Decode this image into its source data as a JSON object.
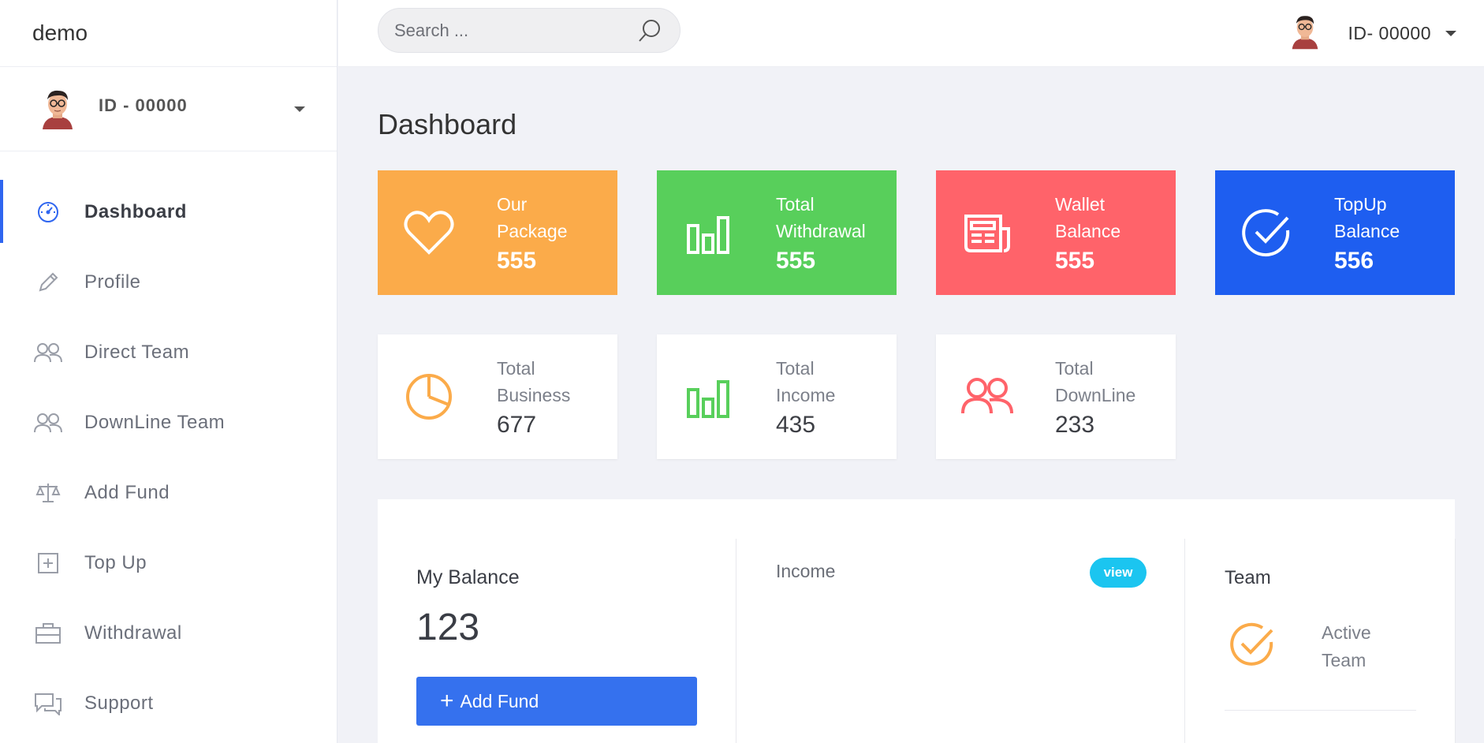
{
  "brand": "demo",
  "sidebar": {
    "user_id": "ID - 00000",
    "items": [
      {
        "label": "Dashboard",
        "icon": "dashboard-gauge-icon",
        "active": true
      },
      {
        "label": "Profile",
        "icon": "pencil-icon"
      },
      {
        "label": "Direct Team",
        "icon": "users-icon"
      },
      {
        "label": "DownLine Team",
        "icon": "users-icon"
      },
      {
        "label": "Add Fund",
        "icon": "scale-icon"
      },
      {
        "label": "Top Up",
        "icon": "plus-square-icon"
      },
      {
        "label": "Withdrawal",
        "icon": "briefcase-icon"
      },
      {
        "label": "Support",
        "icon": "chat-icon"
      }
    ]
  },
  "header": {
    "search_placeholder": "Search ...",
    "user_id": "ID- 00000"
  },
  "page_title": "Dashboard",
  "cards_top": [
    {
      "label1": "Our",
      "label2": "Package",
      "value": "555",
      "color": "#fbab4a",
      "icon": "heart-icon"
    },
    {
      "label1": "Total",
      "label2": "Withdrawal",
      "value": "555",
      "color": "#58cf5b",
      "icon": "bar-chart-icon"
    },
    {
      "label1": "Wallet",
      "label2": "Balance",
      "value": "555",
      "color": "#ff636a",
      "icon": "newspaper-icon"
    },
    {
      "label1": "TopUp",
      "label2": "Balance",
      "value": "556",
      "color": "#1e5ef0",
      "icon": "check-circle-icon"
    }
  ],
  "cards_bottom": [
    {
      "label1": "Total",
      "label2": "Business",
      "value": "677",
      "color": "#fbab4a",
      "icon": "pie-chart-icon"
    },
    {
      "label1": "Total",
      "label2": "Income",
      "value": "435",
      "color": "#58cf5b",
      "icon": "bar-chart-icon"
    },
    {
      "label1": "Total",
      "label2": "DownLine",
      "value": "233",
      "color": "#ff636a",
      "icon": "users-icon"
    }
  ],
  "balance": {
    "title": "My Balance",
    "value": "123",
    "button_label": "Add Fund"
  },
  "income": {
    "title": "Income",
    "badge": "view"
  },
  "team": {
    "title": "Team",
    "label1": "Active",
    "label2": "Team"
  }
}
